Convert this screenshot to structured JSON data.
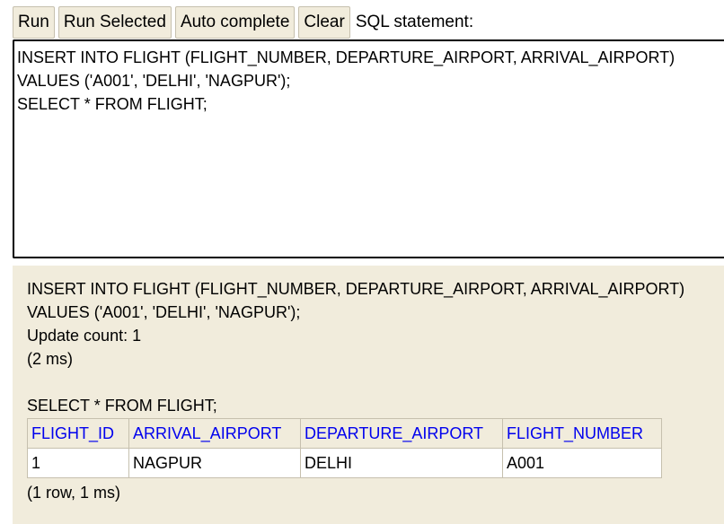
{
  "toolbar": {
    "run_label": "Run",
    "run_selected_label": "Run Selected",
    "auto_complete_label": "Auto complete",
    "clear_label": "Clear",
    "sql_statement_label": "SQL statement:"
  },
  "editor": {
    "value": "INSERT INTO FLIGHT (FLIGHT_NUMBER, DEPARTURE_AIRPORT, ARRIVAL_AIRPORT)\nVALUES ('A001', 'DELHI', 'NAGPUR');\nSELECT * FROM FLIGHT;"
  },
  "results": {
    "insert": {
      "line1": "INSERT INTO FLIGHT (FLIGHT_NUMBER, DEPARTURE_AIRPORT, ARRIVAL_AIRPORT)",
      "line2": "VALUES ('A001', 'DELHI', 'NAGPUR');",
      "update_count": "Update count: 1",
      "timing": "(2 ms)"
    },
    "select": {
      "statement": "SELECT * FROM FLIGHT;",
      "columns": [
        "FLIGHT_ID",
        "ARRIVAL_AIRPORT",
        "DEPARTURE_AIRPORT",
        "FLIGHT_NUMBER"
      ],
      "rows": [
        [
          "1",
          "NAGPUR",
          "DELHI",
          "A001"
        ]
      ],
      "summary": "(1 row, 1 ms)"
    }
  },
  "colors": {
    "panel_bg": "#f1ecdc",
    "header_link": "#0000ee",
    "border": "#c6c0ae"
  }
}
